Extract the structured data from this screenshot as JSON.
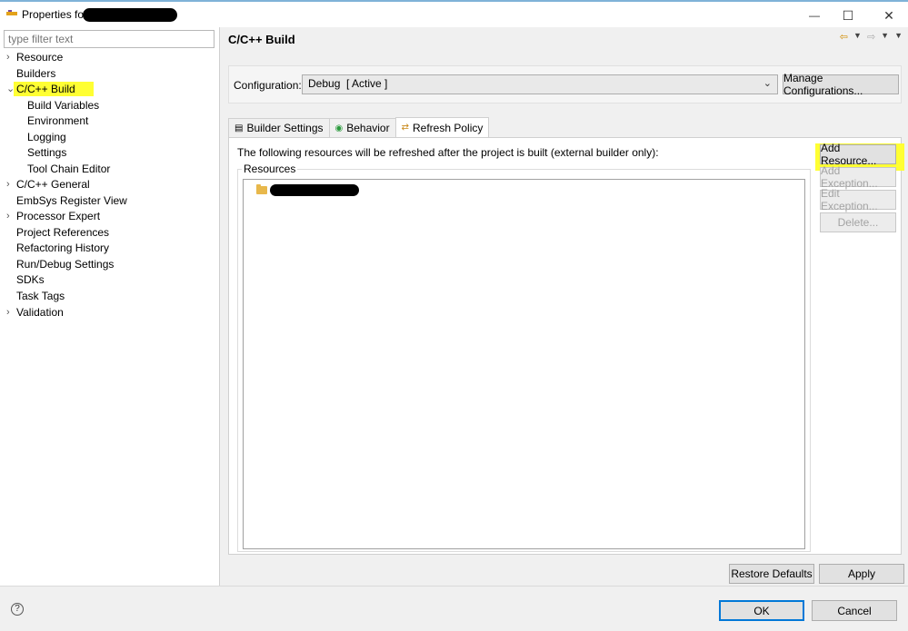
{
  "window": {
    "title": "Properties for",
    "minimize": "—",
    "maximize": "☐",
    "close": "✕"
  },
  "sidebar": {
    "filter_placeholder": "type filter text",
    "items": [
      {
        "label": "Resource",
        "expandable": true,
        "level": 0
      },
      {
        "label": "Builders",
        "expandable": false,
        "level": 0
      },
      {
        "label": "C/C++ Build",
        "expandable": true,
        "expanded": true,
        "selected": true,
        "level": 0
      },
      {
        "label": "Build Variables",
        "level": 1
      },
      {
        "label": "Environment",
        "level": 1
      },
      {
        "label": "Logging",
        "level": 1
      },
      {
        "label": "Settings",
        "level": 1
      },
      {
        "label": "Tool Chain Editor",
        "level": 1
      },
      {
        "label": "C/C++ General",
        "expandable": true,
        "level": 0
      },
      {
        "label": "EmbSys Register View",
        "level": 0
      },
      {
        "label": "Processor Expert",
        "expandable": true,
        "level": 0
      },
      {
        "label": "Project References",
        "level": 0
      },
      {
        "label": "Refactoring History",
        "level": 0
      },
      {
        "label": "Run/Debug Settings",
        "level": 0
      },
      {
        "label": "SDKs",
        "level": 0
      },
      {
        "label": "Task Tags",
        "level": 0
      },
      {
        "label": "Validation",
        "expandable": true,
        "level": 0
      }
    ]
  },
  "main": {
    "title": "C/C++ Build",
    "configuration_label": "Configuration:",
    "configuration_value": "Debug  [ Active ]",
    "manage_configurations": "Manage Configurations...",
    "tabs": [
      {
        "label": "Builder Settings",
        "icon": "builder-settings-icon"
      },
      {
        "label": "Behavior",
        "icon": "behavior-icon"
      },
      {
        "label": "Refresh Policy",
        "icon": "refresh-policy-icon",
        "active": true
      }
    ],
    "description": "The following resources will be refreshed after the project is built (external builder only):",
    "resources_label": "Resources",
    "side_buttons": {
      "add_resource": "Add Resource...",
      "add_exception": "Add Exception...",
      "edit_exception": "Edit Exception...",
      "delete": "Delete..."
    },
    "restore_defaults": "Restore Defaults",
    "apply": "Apply"
  },
  "footer": {
    "help": "?",
    "ok": "OK",
    "cancel": "Cancel"
  },
  "colors": {
    "highlight": "#ffff33",
    "accent": "#0078d7"
  }
}
